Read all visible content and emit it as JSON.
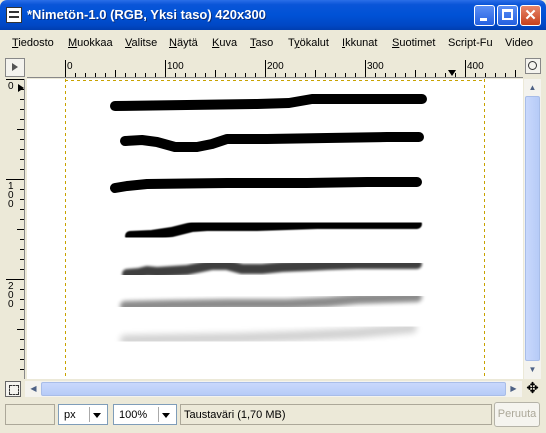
{
  "window": {
    "title": "*Nimetön-1.0 (RGB, Yksi taso) 420x300"
  },
  "menu": [
    {
      "pre": "",
      "u": "T",
      "post": "iedosto"
    },
    {
      "pre": "",
      "u": "M",
      "post": "uokkaa"
    },
    {
      "pre": "",
      "u": "V",
      "post": "alitse"
    },
    {
      "pre": "",
      "u": "N",
      "post": "äytä"
    },
    {
      "pre": "",
      "u": "K",
      "post": "uva"
    },
    {
      "pre": "",
      "u": "T",
      "post": "aso"
    },
    {
      "pre": "T",
      "u": "y",
      "post": "ökalut"
    },
    {
      "pre": "",
      "u": "I",
      "post": "kkunat"
    },
    {
      "pre": "",
      "u": "S",
      "post": "uotimet"
    },
    {
      "pre": "",
      "u": "",
      "post": "Script-Fu"
    },
    {
      "pre": "",
      "u": "",
      "post": "Video"
    }
  ],
  "hruler": {
    "labels": [
      "0",
      "100",
      "200",
      "300",
      "400"
    ]
  },
  "vruler": {
    "labels": [
      "0",
      "1\n0\n0",
      "2\n0\n0"
    ]
  },
  "canvas": {
    "strokes": [
      {
        "blur": 0,
        "opacity": 1
      },
      {
        "blur": 0,
        "opacity": 1
      },
      {
        "blur": 0,
        "opacity": 1
      },
      {
        "blur": 0.6,
        "opacity": 1
      },
      {
        "blur": 1.4,
        "opacity": 0.75
      },
      {
        "blur": 2.2,
        "opacity": 0.45
      },
      {
        "blur": 3.2,
        "opacity": 0.18
      }
    ]
  },
  "status": {
    "unit": "px",
    "zoom": "100%",
    "message": "Taustaväri (1,70 MB)",
    "cancel": "Peruuta"
  }
}
